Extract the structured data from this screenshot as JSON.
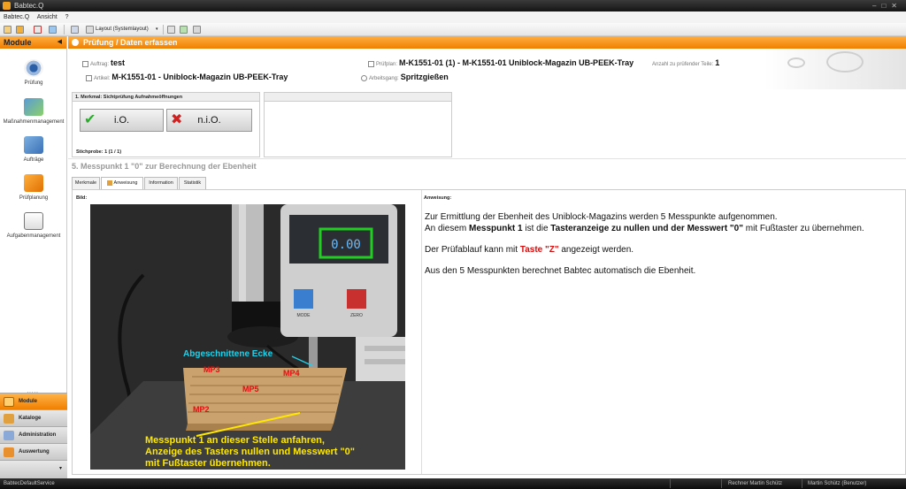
{
  "window": {
    "title": "Babtec.Q"
  },
  "menu": {
    "items": [
      "Babtec.Q",
      "Ansicht",
      "?"
    ]
  },
  "toolbar": {
    "layout_label": "Layout (Systemlayout)"
  },
  "sidebar": {
    "header": "Module",
    "modules": [
      "Prüfung",
      "Maßnahmenmanagement",
      "Aufträge",
      "Prüfplanung",
      "Aufgabenmanagement"
    ],
    "categories": [
      "Module",
      "Kataloge",
      "Administration",
      "Auswertung"
    ]
  },
  "main": {
    "header": "Prüfung / Daten erfassen",
    "fields": {
      "auftrag_label": "Auftrag:",
      "auftrag_value": "test",
      "artikel_label": "Artikel:",
      "artikel_value": "M-K1551-01 - Uniblock-Magazin UB-PEEK-Tray",
      "pruefplan_label": "Prüfplan:",
      "pruefplan_value": "M-K1551-01 (1) - M-K1551-01  Uniblock-Magazin UB-PEEK-Tray",
      "anzahl_label": "Anzahl zu prüfender Teile:",
      "anzahl_value": "1",
      "arbeitsgang_label": "Arbeitsgang:",
      "arbeitsgang_value": "Spritzgießen"
    },
    "merkmal": {
      "title": "1. Merkmal: Sichtprüfung Aufnahmeöffnungen",
      "ok_label": "i.O.",
      "nok_label": "n.i.O.",
      "stichprobe": "Stichprobe: 1 (1 / 1)"
    },
    "section_title": "5. Messpunkt 1 \"0\" zur Berechnung der Ebenheit",
    "tabs": [
      "Merkmale",
      "Anweisung",
      "Information",
      "Statistik"
    ],
    "bild_label": "Bild:",
    "anweisung_label": "Anweisung:",
    "anweisung": {
      "p1_line1": "Zur Ermittlung der Ebenheit des Uniblock-Magazins werden 5 Messpunkte aufgenommen.",
      "p1_pre": "An diesem ",
      "p1_bold1": "Messpunkt 1",
      "p1_mid": " ist die ",
      "p1_bold2": "Tasteranzeige zu nullen und der Messwert \"0\"",
      "p1_post": " mit Fußtaster zu übernehmen.",
      "p2_pre": "Der Prüfablauf kann mit ",
      "p2_red": "Taste \"Z\"",
      "p2_post": " angezeigt werden.",
      "p3": "Aus den 5 Messpunkten berechnet Babtec automatisch die Ebenheit."
    },
    "photo": {
      "display": "0.00",
      "mode_label": "MODE",
      "zero_label": "ZERO",
      "corner_label": "Abgeschnittene Ecke",
      "mp_labels": [
        "MP3",
        "MP4",
        "MP5",
        "MP2"
      ],
      "caption": [
        "Messpunkt 1 an dieser Stelle anfahren,",
        "Anzeige des Tasters nullen und Messwert \"0\"",
        "mit Fußtaster übernehmen."
      ]
    }
  },
  "status": {
    "service": "BabtecDefaultService",
    "computer": "Rechner Martin Schütz",
    "user": "Martin Schütz (Benutzer)"
  },
  "colors": {
    "accent": "#f08000",
    "ok": "#2fa82f",
    "nok": "#d02020",
    "caption": "#ffe800",
    "annotation": "#22d0e8",
    "mp": "#e01010"
  }
}
